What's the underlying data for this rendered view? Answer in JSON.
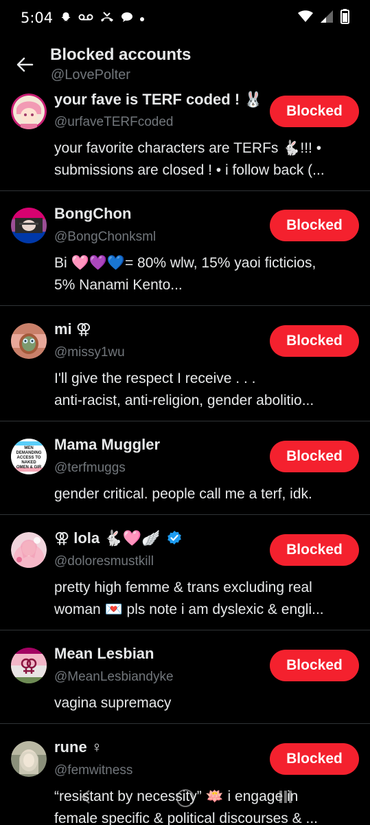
{
  "status_bar": {
    "time": "5:04",
    "icons": [
      "snapchat-icon",
      "voicemail-icon",
      "missed-call-icon",
      "chat-bubble-icon",
      "dot-icon",
      "wifi-icon",
      "signal-icon",
      "battery-icon"
    ]
  },
  "header": {
    "title": "Blocked accounts",
    "handle": "@LovePolter",
    "back_icon": "arrow-left-icon"
  },
  "accounts": [
    {
      "name": "your fave is TERF coded ! 🐰",
      "handle": "@urfaveTERFcoded",
      "bio_lines": [
        "your favorite characters are TERFs 🐇!!! •",
        "submissions are closed ! • i follow back (..."
      ],
      "button": "Blocked"
    },
    {
      "name": "BongChon",
      "handle": "@BongChonksml",
      "bio_lines": [
        "Bi 🩷💜💙= 80% wlw,  15% yaoi ficticios,",
        "5% Nanami Kento..."
      ],
      "button": "Blocked"
    },
    {
      "name": "mi ⚢",
      "handle": "@missy1wu",
      "bio_lines": [
        "I'll give the respect I receive . . .",
        "anti-racist, anti-religion, gender abolitio..."
      ],
      "button": "Blocked"
    },
    {
      "name": "Mama Muggler",
      "handle": "@terfmuggs",
      "bio_lines": [
        "gender critical. people call me a terf, idk."
      ],
      "button": "Blocked",
      "avatar_text": [
        "MEN",
        "DEMANDING",
        "ACCESS TO",
        "NAKED",
        "OMEN & GIR"
      ]
    },
    {
      "name": "⚢ lola 🐇🩷🪽",
      "handle": "@doloresmustkill",
      "bio_lines": [
        "pretty high femme & trans excluding real",
        "woman 💌 pls note i am dyslexic & engli..."
      ],
      "button": "Blocked",
      "verified": true
    },
    {
      "name": "Mean Lesbian",
      "handle": "@MeanLesbiandyke",
      "bio_lines": [
        "vagina supremacy"
      ],
      "button": "Blocked"
    },
    {
      "name": "rune ♀",
      "handle": "@femwitness",
      "bio_lines": [
        "“resistant by necessity” 🪷 i engage in",
        "female specific & political discourses & ..."
      ],
      "button": "Blocked"
    }
  ],
  "colors": {
    "background": "#000000",
    "button": "#f4212e",
    "text_primary": "#e7e9ea",
    "text_secondary": "#71767b",
    "divider": "#2f3336",
    "verified": "#1d9bf0"
  },
  "nav_bar": [
    "back-nav-icon",
    "home-nav-icon",
    "recents-nav-icon"
  ]
}
